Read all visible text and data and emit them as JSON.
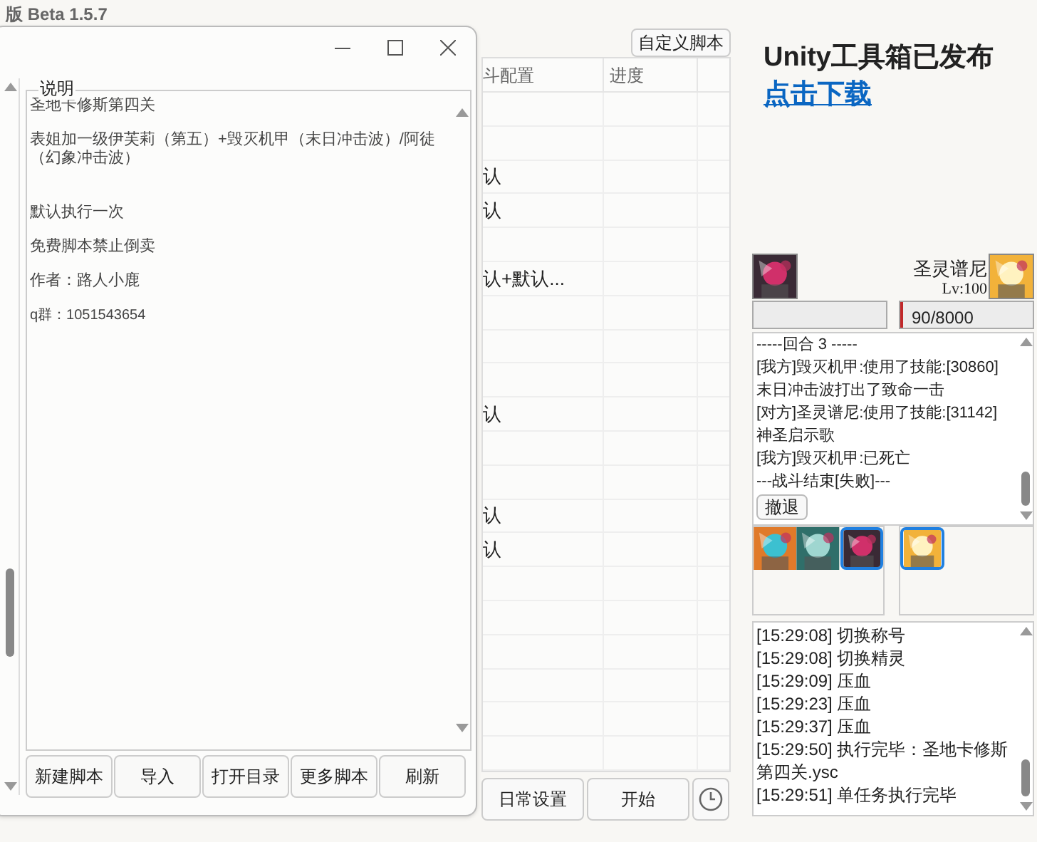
{
  "app_title": "版 Beta 1.5.7",
  "table": {
    "custom_button": "自定义脚本",
    "columns": [
      "斗配置",
      "进度"
    ],
    "rows": [
      {},
      {},
      {
        "config": "认"
      },
      {
        "config": "认"
      },
      {},
      {
        "config": "认+默认..."
      },
      {},
      {},
      {},
      {
        "config": "认"
      },
      {},
      {},
      {
        "config": "认"
      },
      {
        "config": "认"
      },
      {},
      {},
      {},
      {},
      {},
      {}
    ],
    "buttons": [
      "日常设置",
      "开始"
    ]
  },
  "promo": {
    "title": "Unity工具箱已发布",
    "link": "点击下载"
  },
  "battle": {
    "enemy_name": "圣灵谱尼",
    "enemy_level": "Lv:100",
    "enemy_hp": {
      "level": 0.011,
      "reading": "90/8000"
    },
    "log": [
      "-----回合 3 -----",
      "[我方]毁灭机甲:使用了技能:[30860]",
      "末日冲击波打出了致命一击",
      "[对方]圣灵谱尼:使用了技能:[31142]",
      "神圣启示歌",
      "[我方]毁灭机甲:已死亡",
      "---战斗结束[失败]---"
    ],
    "retreat_button": "撤退",
    "my_team": [
      {
        "selected": false
      },
      {
        "selected": false
      },
      {
        "selected": true
      }
    ],
    "enemy_team": [
      {
        "selected": true
      }
    ]
  },
  "run_log": [
    "[15:29:08] 切换称号",
    "[15:29:08] 切换精灵",
    "[15:29:09] 压血",
    "[15:29:23] 压血",
    "[15:29:37] 压血",
    "[15:29:50] 执行完毕：圣地卡修斯第四关.ysc",
    "[15:29:51] 单任务执行完毕"
  ],
  "dialog": {
    "group_title": "说明",
    "paragraphs": [
      "圣地卡修斯第四关",
      "表姐加一级伊芙莉（第五）+毁灭机甲（末日冲击波）/阿徒（幻象冲击波）",
      "默认执行一次",
      "免费脚本禁止倒卖",
      "作者：路人小鹿",
      "q群：1051543654"
    ],
    "buttons": [
      "新建脚本",
      "导入",
      "打开目录",
      "更多脚本",
      "刷新"
    ]
  }
}
